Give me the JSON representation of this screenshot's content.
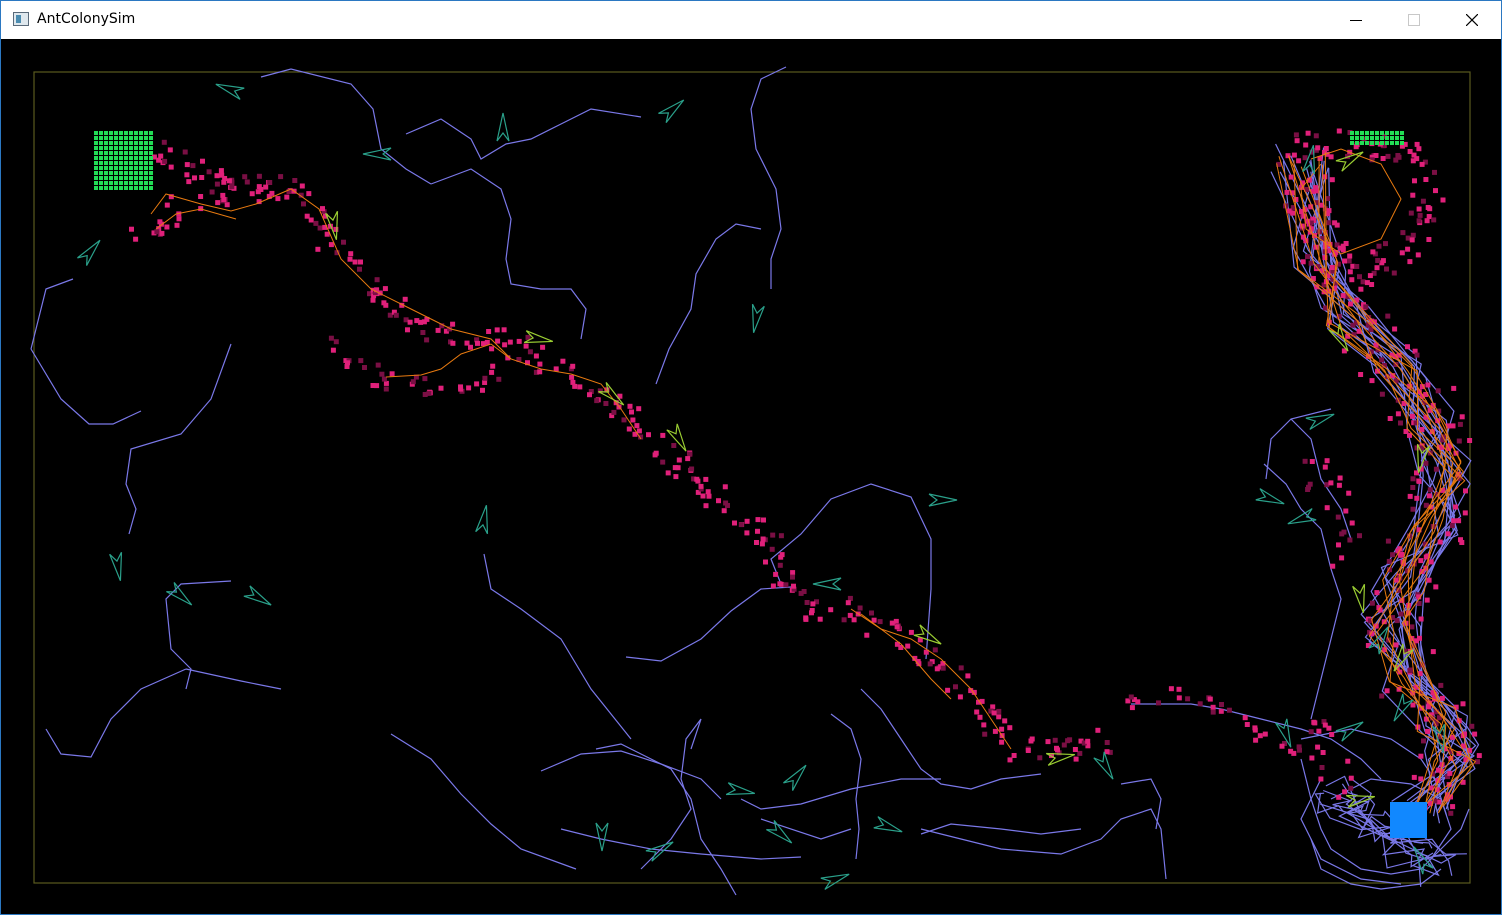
{
  "window": {
    "title": "AntColonySim",
    "icons": {
      "app": "app-window-icon",
      "minimize": "minimize-icon",
      "maximize": "maximize-icon",
      "close": "close-icon"
    }
  },
  "colors": {
    "titlebar_bg": "#ffffff",
    "canvas_bg": "#000000",
    "boundary": "#5a5a1e",
    "food": "#22dd55",
    "nest": "#1188ff",
    "pheromone_home": "#e0207a",
    "pheromone_home_faded": "#7a0f44",
    "wander_path": "#7a78e8",
    "food_path": "#e87a10",
    "ant_searching": "#2aa08a",
    "ant_carrying": "#9acd32"
  }
}
